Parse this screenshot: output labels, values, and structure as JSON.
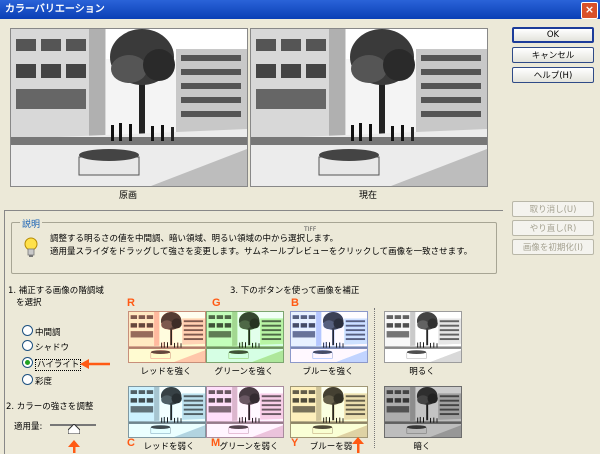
{
  "window": {
    "title": "カラーバリエーション",
    "close": "×"
  },
  "preview": {
    "original_label": "原画",
    "current_label": "現在"
  },
  "buttons": {
    "ok": "OK",
    "cancel": "キャンセル",
    "help": "ヘルプ(H)",
    "undo": "取り消し(U)",
    "redo": "やり直し(R)",
    "reset": "画像を初期化(I)"
  },
  "description": {
    "legend": "説明",
    "tag": "TIFF",
    "line1": "調整する明るさの値を中間調、暗い領域、明るい領域の中から選択します。",
    "line2": "適用量スライダをドラッグして強さを変更します。サムネールプレビューをクリックして画像を一致させます。"
  },
  "section1": {
    "line1": "1. 補正する画像の階調域",
    "line2": "を選択"
  },
  "section3": {
    "title": "3. 下のボタンを使って画像を補正"
  },
  "tones": [
    {
      "label": "中間調",
      "selected": false
    },
    {
      "label": "シャドウ",
      "selected": false
    },
    {
      "label": "ハイライト",
      "selected": true
    },
    {
      "label": "彩度",
      "selected": false
    }
  ],
  "section2": {
    "title": "2. カラーの強さを調整",
    "amount_label": "適用量:"
  },
  "thumbnails": {
    "red_up": "レッドを強く",
    "green_up": "グリーンを強く",
    "blue_up": "ブルーを強く",
    "lighter": "明るく",
    "red_down": "レッドを弱く",
    "green_down": "グリーンを弱く",
    "blue_down": "ブルーを弱",
    "darker": "暗く"
  },
  "letters": {
    "r": "R",
    "g": "G",
    "b": "B",
    "c": "C",
    "m": "M",
    "y": "Y"
  },
  "annotation_color": "#ff5a14"
}
